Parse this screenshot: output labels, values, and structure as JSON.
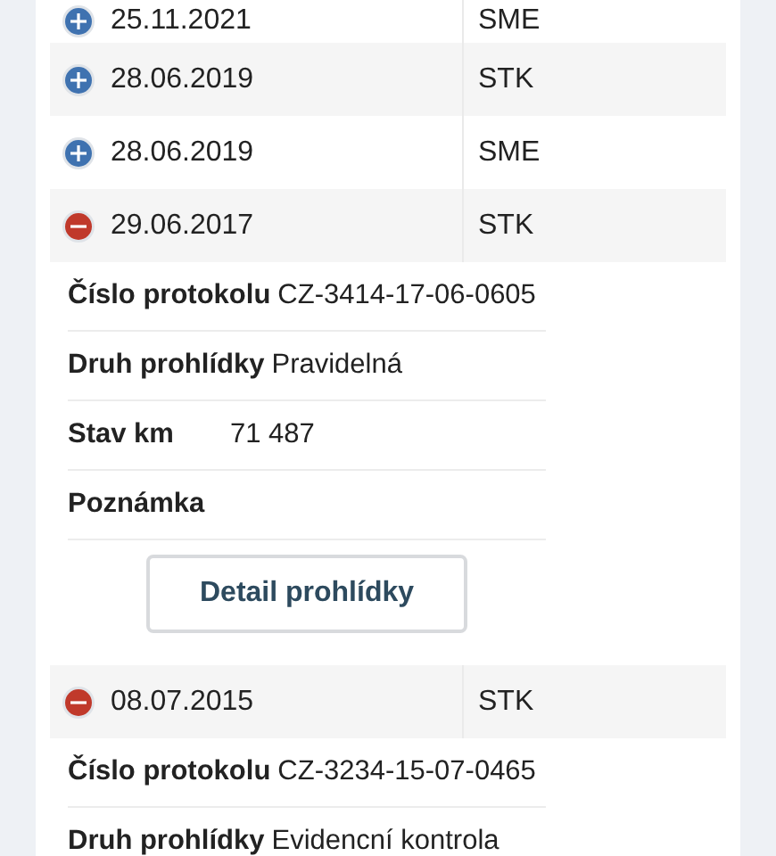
{
  "inspections": [
    {
      "expanded": false,
      "date": "25.11.2021",
      "type": "SME"
    },
    {
      "expanded": false,
      "date": "28.06.2019",
      "type": "STK"
    },
    {
      "expanded": false,
      "date": "28.06.2019",
      "type": "SME"
    },
    {
      "expanded": true,
      "date": "29.06.2017",
      "type": "STK",
      "details": [
        {
          "label": "Číslo protokolu",
          "value": "CZ-3414-17-06-0605"
        },
        {
          "label": "Druh prohlídky",
          "value": "Pravidelná"
        },
        {
          "label": "Stav km",
          "value": "71 487"
        },
        {
          "label": "Poznámka"
        }
      ],
      "button": "Detail prohlídky"
    },
    {
      "expanded": true,
      "date": "08.07.2015",
      "type": "STK",
      "details": [
        {
          "label": "Číslo protokolu",
          "value": "CZ-3234-15-07-0465"
        },
        {
          "label": "Druh prohlídky",
          "value": "Evidencní kontrola"
        }
      ]
    }
  ]
}
